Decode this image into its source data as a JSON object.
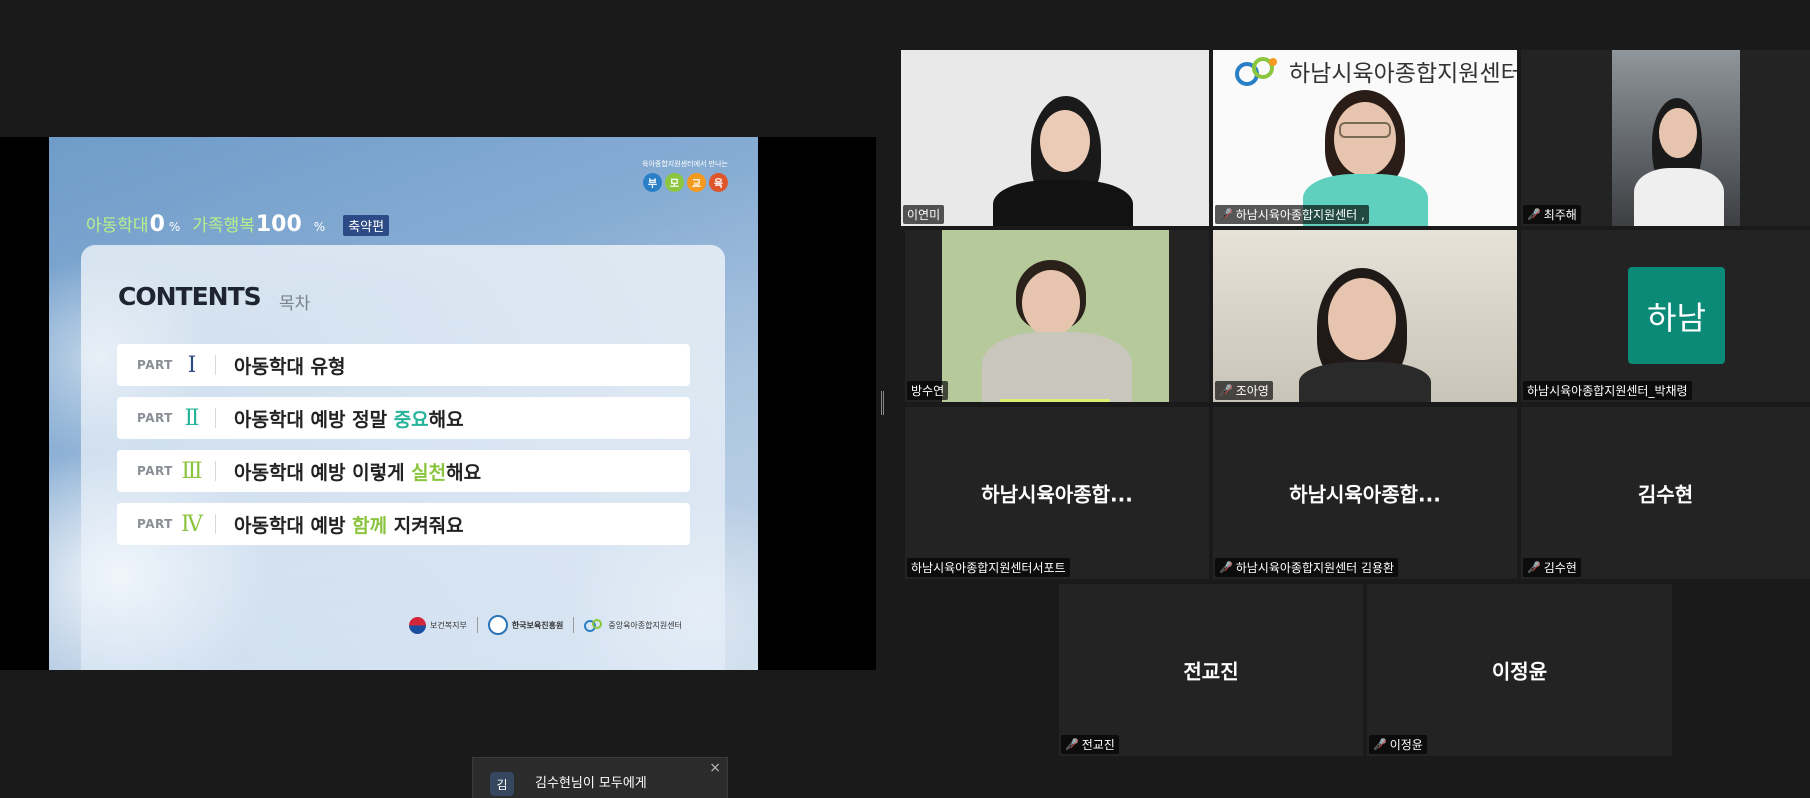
{
  "slide": {
    "brand_top": "육아종합지원센터에서 만나는",
    "brand_chars": [
      {
        "char": "부",
        "color": "#2a7fc6"
      },
      {
        "char": "모",
        "color": "#8cc63f"
      },
      {
        "char": "교",
        "color": "#f39a1f"
      },
      {
        "char": "육",
        "color": "#e0562c"
      }
    ],
    "headline": {
      "part1": "아동학대",
      "num1": "0",
      "pct1": "%",
      "part2": "가족행복",
      "num2": "100",
      "pct2": "%",
      "tag": "축약편"
    },
    "contents_title": "CONTENTS",
    "contents_sub": "목차",
    "part_label": "PART",
    "items": [
      {
        "roman": "Ⅰ",
        "roman_color": "#2c4a86",
        "text_before": "아동학대 유형",
        "highlight": "",
        "text_after": ""
      },
      {
        "roman": "Ⅱ",
        "roman_color": "#25b39a",
        "text_before": "아동학대 예방 정말 ",
        "highlight": "중요",
        "text_after": "해요"
      },
      {
        "roman": "Ⅲ",
        "roman_color": "#8bc53f",
        "text_before": "아동학대 예방 이렇게 ",
        "highlight": "실천",
        "text_after": "해요"
      },
      {
        "roman": "Ⅳ",
        "roman_color": "#8bc53f",
        "text_before": "아동학대 예방 ",
        "highlight": "함께",
        "text_after": " 지켜줘요"
      }
    ],
    "footer": {
      "org1": "보건복지부",
      "org2": "한국보육진흥원",
      "org3": "중앙육아종합지원센터"
    }
  },
  "participants": [
    {
      "name": "이연미",
      "muted": false,
      "active": true
    },
    {
      "name": "하남시육아종합지원센터 ,",
      "muted": true,
      "bg_text": "하남시육아종합지원센터"
    },
    {
      "name": "최주해",
      "muted": true
    },
    {
      "name": "방수연",
      "muted": false
    },
    {
      "name": "조아영",
      "muted": true
    },
    {
      "name": "하남시육아종합지원센터_박채령",
      "muted": false,
      "avatar_text": "하남",
      "avatar_color": "#0b8a78"
    },
    {
      "name": "하남시육아종합지원센터서포트",
      "muted": false,
      "display": "하남시육아종합..."
    },
    {
      "name": "하남시육아종합지원센터 김용환",
      "muted": true,
      "display": "하남시육아종합..."
    },
    {
      "name": "김수현",
      "muted": true,
      "display": "김수현"
    },
    {
      "name": "전교진",
      "muted": true,
      "display": "전교진"
    },
    {
      "name": "이정윤",
      "muted": true,
      "display": "이정윤"
    }
  ],
  "chat": {
    "avatar": "김",
    "message": "김수현님이 모두에게",
    "close": "×"
  }
}
